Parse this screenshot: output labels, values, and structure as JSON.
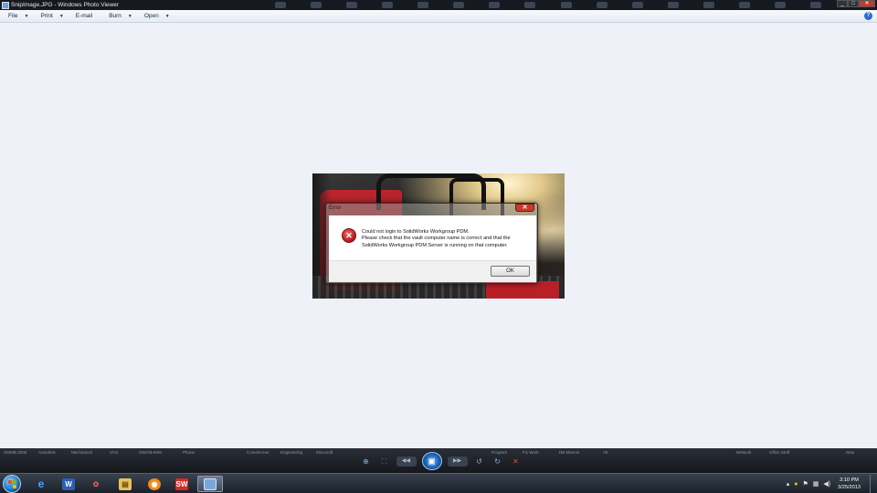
{
  "window": {
    "title": "SnipImage.JPG - Windows Photo Viewer"
  },
  "menubar": {
    "items": [
      {
        "label": "File"
      },
      {
        "label": "Print"
      },
      {
        "label": "E-mail"
      },
      {
        "label": "Burn"
      },
      {
        "label": "Open"
      }
    ],
    "help_icon": "help-icon",
    "help_glyph": "?"
  },
  "dialog": {
    "title": "Error",
    "close_glyph": "✕",
    "icon": "error-icon",
    "icon_glyph": "✕",
    "message_line1": "Could not login to SolidWorks Workgroup PDM.",
    "message_line2": "Please check that the vault computer name is correct and that the SolidWorks Workgroup PDM Server is running on that computer.",
    "ok_label": "OK"
  },
  "controlbar": {
    "faded_labels": [
      "SWMB 2006",
      "Autodesk",
      "Mechanical",
      "VCS",
      "SW/AB-IMM",
      "Phone",
      "Convert.exe",
      "Engineering",
      "Microsoft",
      "Program",
      "SolidWorks",
      "Office Tools",
      "Fix Work",
      "DB Macros",
      "Alt",
      "Network",
      "Office Stuff",
      "New"
    ],
    "buttons": [
      "zoom-icon",
      "actual-size-icon",
      "previous-icon",
      "slideshow-icon",
      "next-icon",
      "rotate-ccw-icon",
      "rotate-cw-icon",
      "delete-icon"
    ]
  },
  "taskbar": {
    "apps": [
      "internet-explorer-icon",
      "word-icon",
      "paint-icon",
      "explorer-icon",
      "media-icon",
      "solidworks-icon",
      "photo-viewer-icon"
    ],
    "clock_time": "3:10 PM",
    "clock_date": "3/25/2013",
    "tray_icons": [
      "show-hidden-icon",
      "norton-icon",
      "action-center-flag-icon",
      "network-icon",
      "volume-icon"
    ]
  }
}
